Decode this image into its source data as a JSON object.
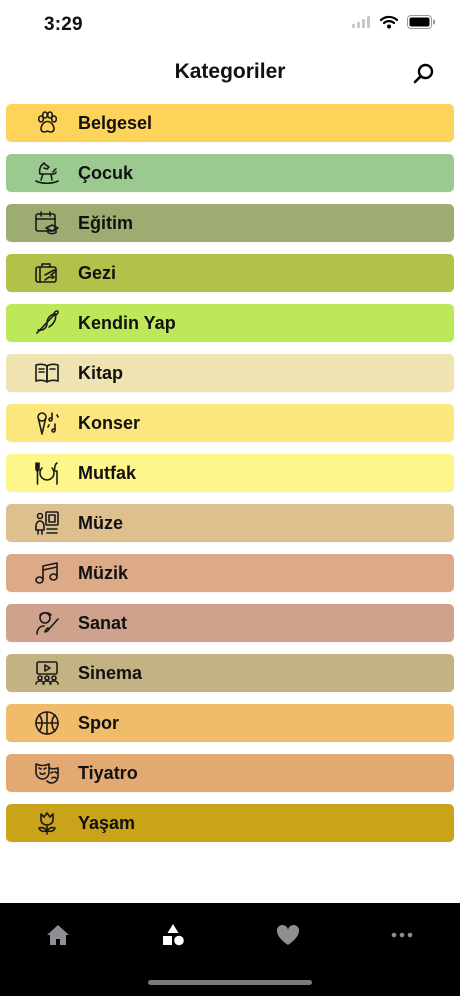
{
  "status_bar": {
    "time": "3:29"
  },
  "header": {
    "title": "Kategoriler"
  },
  "categories": [
    {
      "label": "Belgesel",
      "color": "#FDD35A",
      "icon": "paw-icon"
    },
    {
      "label": "Çocuk",
      "color": "#9BC98F",
      "icon": "rocking-horse-icon"
    },
    {
      "label": "Eğitim",
      "color": "#9DAD72",
      "icon": "calendar-graduation-icon"
    },
    {
      "label": "Gezi",
      "color": "#B1C14A",
      "icon": "luggage-plane-icon"
    },
    {
      "label": "Kendin Yap",
      "color": "#BDE85A",
      "icon": "needle-thread-icon"
    },
    {
      "label": "Kitap",
      "color": "#F0E3B2",
      "icon": "open-book-icon"
    },
    {
      "label": "Konser",
      "color": "#FCE77F",
      "icon": "microphone-music-icon"
    },
    {
      "label": "Mutfak",
      "color": "#FEF58B",
      "icon": "plate-cutlery-icon"
    },
    {
      "label": "Müze",
      "color": "#DEC08F",
      "icon": "museum-visitor-icon"
    },
    {
      "label": "Müzik",
      "color": "#DCAA87",
      "icon": "music-note-icon"
    },
    {
      "label": "Sanat",
      "color": "#CFA28E",
      "icon": "artist-brush-icon"
    },
    {
      "label": "Sinema",
      "color": "#C3B383",
      "icon": "cinema-audience-icon"
    },
    {
      "label": "Spor",
      "color": "#F0BC6B",
      "icon": "basketball-icon"
    },
    {
      "label": "Tiyatro",
      "color": "#E3A973",
      "icon": "theater-mask-icon"
    },
    {
      "label": "Yaşam",
      "color": "#C9A319",
      "icon": "tulip-icon"
    }
  ],
  "tab_bar": {
    "tabs": [
      {
        "icon": "home-icon",
        "active": false
      },
      {
        "icon": "shapes-icon",
        "active": true
      },
      {
        "icon": "heart-icon",
        "active": false
      },
      {
        "icon": "more-icon",
        "active": false
      }
    ],
    "active_color": "#ffffff",
    "inactive_color": "#8e8e93"
  }
}
